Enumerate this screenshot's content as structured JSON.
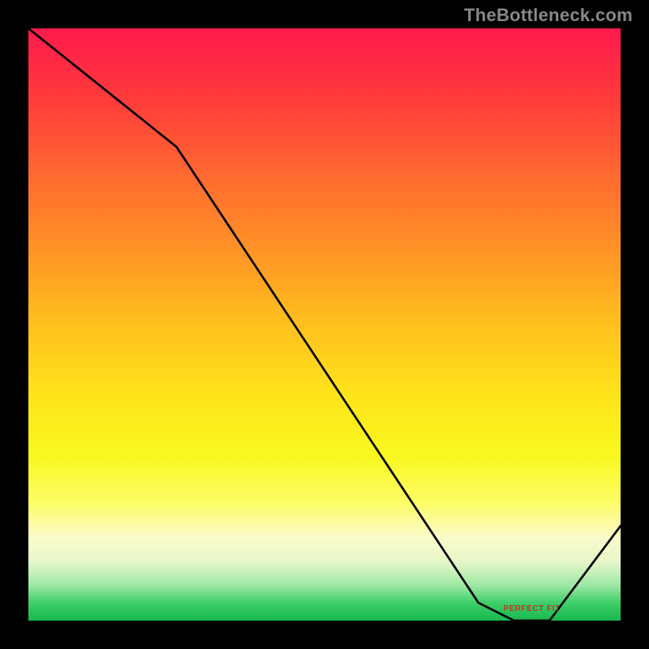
{
  "watermark": "TheBottleneck.com",
  "perfect_fit_label": "PERFECT FIT",
  "chart_data": {
    "type": "line",
    "title": "",
    "xlabel": "",
    "ylabel": "",
    "xlim": [
      0,
      100
    ],
    "ylim": [
      0,
      100
    ],
    "grid": false,
    "series": [
      {
        "name": "curve",
        "x": [
          0,
          25,
          76,
          82,
          88,
          100
        ],
        "values": [
          100,
          80,
          3,
          0,
          0,
          16
        ]
      }
    ],
    "axes_visible": false,
    "reference_bands": [
      {
        "name": "red",
        "y_from": 80,
        "y_to": 100
      },
      {
        "name": "orange",
        "y_from": 40,
        "y_to": 80
      },
      {
        "name": "yellow",
        "y_from": 12,
        "y_to": 40
      },
      {
        "name": "green",
        "y_from": 0,
        "y_to": 12
      }
    ],
    "annotations": [
      {
        "text": "PERFECT FIT",
        "x": 85,
        "y": 1
      }
    ]
  }
}
